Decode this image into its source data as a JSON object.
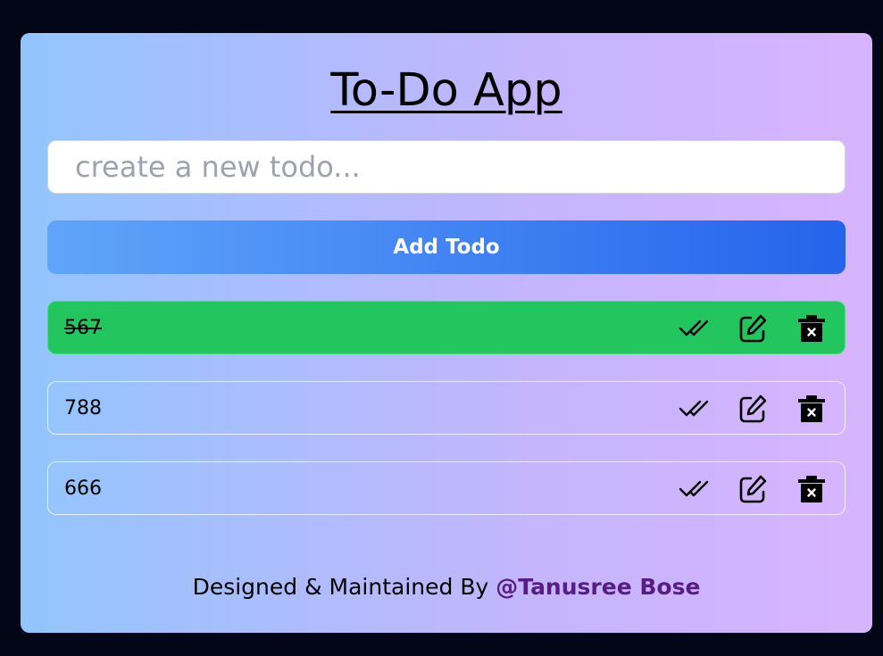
{
  "app": {
    "title": "To-Do App"
  },
  "new_todo": {
    "placeholder": "create a new todo...",
    "value": ""
  },
  "add_button": {
    "label": "Add Todo"
  },
  "todos": [
    {
      "text": "567",
      "completed": true
    },
    {
      "text": "788",
      "completed": false
    },
    {
      "text": "666",
      "completed": false
    }
  ],
  "icons": {
    "complete": "double-check-icon",
    "edit": "edit-icon",
    "delete": "trash-icon"
  },
  "footer": {
    "prefix": "Designed & Maintained By",
    "author": "@Tanusree Bose"
  },
  "colors": {
    "background": "#030617",
    "completed": "#22c55e",
    "button_start": "#60a5fa",
    "button_end": "#2563eb",
    "author": "#581c87"
  }
}
